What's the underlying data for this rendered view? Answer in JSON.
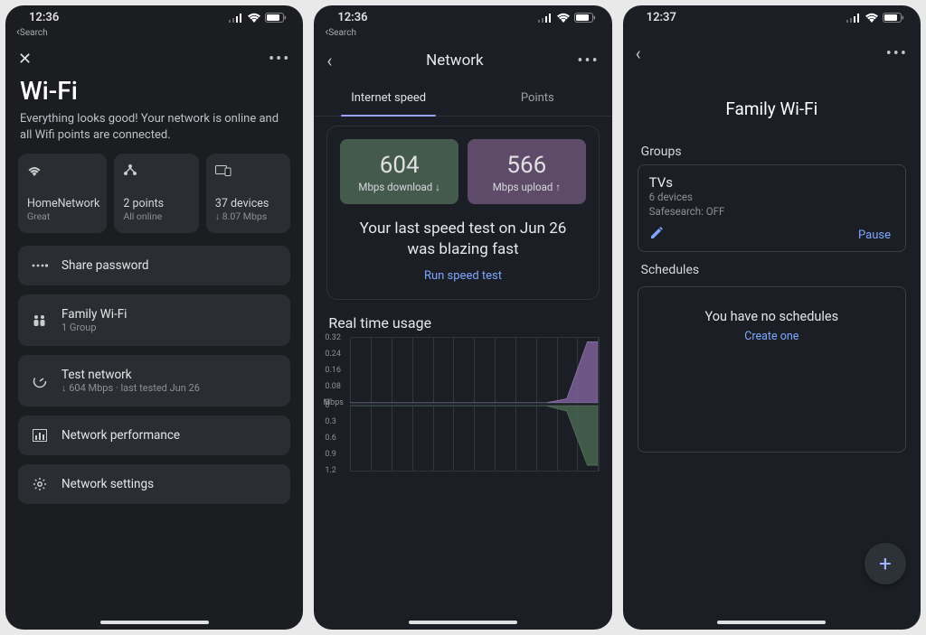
{
  "status": {
    "time1": "12:36",
    "time2": "12:36",
    "time3": "12:37",
    "back": "Search"
  },
  "p1": {
    "title": "Wi-Fi",
    "subtitle": "Everything looks good! Your network is online and all Wifi points are connected.",
    "cards": [
      {
        "label": "HomeNetwork",
        "sub": "Great"
      },
      {
        "label": "2 points",
        "sub": "All online"
      },
      {
        "label": "37 devices",
        "sub": "↓ 8.07 Mbps"
      }
    ],
    "items": {
      "share": "Share password",
      "family_t": "Family Wi-Fi",
      "family_s": "1 Group",
      "test_t": "Test network",
      "test_s": "↓ 604 Mbps · last tested Jun 26",
      "perf": "Network performance",
      "settings": "Network settings"
    }
  },
  "p2": {
    "title": "Network",
    "tabs": {
      "speed": "Internet speed",
      "points": "Points"
    },
    "dl_num": "604",
    "dl_lab": "Mbps download ↓",
    "ul_num": "566",
    "ul_lab": "Mbps upload ↑",
    "message": "Your last speed test on Jun 26 was blazing fast",
    "run": "Run speed test",
    "realtime": "Real time usage"
  },
  "p3": {
    "title": "Family Wi-Fi",
    "groups_h": "Groups",
    "group": {
      "name": "TVs",
      "devices": "6 devices",
      "safe": "Safesearch: OFF",
      "pause": "Pause"
    },
    "sched_h": "Schedules",
    "sched_empty": "You have no schedules",
    "create": "Create one"
  },
  "chart_data": [
    {
      "type": "area",
      "title": "Real time usage — upload",
      "ylabel": "Mbps",
      "ylim": [
        0,
        0.32
      ],
      "ticks_y": [
        0,
        0.08,
        0.16,
        0.24,
        0.32
      ],
      "x_bins": 12,
      "values": [
        0,
        0,
        0,
        0,
        0,
        0,
        0,
        0,
        0,
        0,
        0.02,
        0.3
      ],
      "color": "#8a6aa5"
    },
    {
      "type": "area",
      "title": "Real time usage — download",
      "ylabel": "Mbps",
      "ylim": [
        0,
        1.2
      ],
      "ticks_y": [
        0,
        0.3,
        0.6,
        0.9,
        1.2
      ],
      "x_bins": 12,
      "inverted": true,
      "values": [
        0,
        0,
        0,
        0,
        0,
        0,
        0,
        0,
        0,
        0,
        0.1,
        1.1
      ],
      "color": "#4d6e56"
    }
  ]
}
